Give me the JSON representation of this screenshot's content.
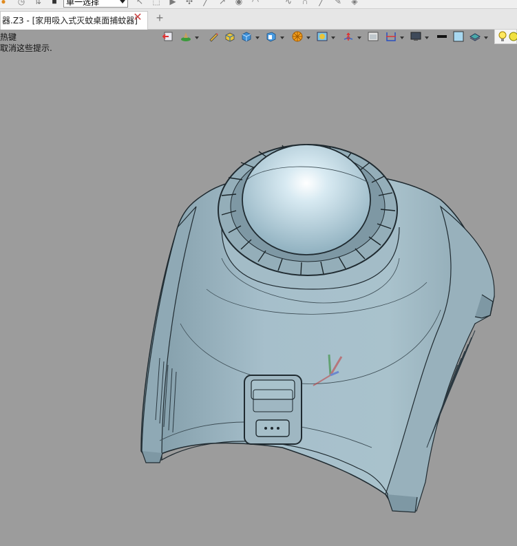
{
  "toolbar": {
    "filter_value": "单一选择",
    "icons": [
      "history-icon",
      "pin-icon",
      "stop-icon",
      "cursor-icon",
      "select-icon",
      "play-icon",
      "point-icon",
      "line-icon",
      "arrow-icon",
      "circle-icon",
      "arc-icon",
      "curve-icon",
      "spline-icon",
      "fillet-icon",
      "trim-icon",
      "brush-icon",
      "layers-icon"
    ]
  },
  "tabs": {
    "active_label": "器.Z3 - [家用吸入式灭蚊桌面捕蚊器]",
    "close_glyph": "✕",
    "add_glyph": "+"
  },
  "hints": {
    "line1": "热键",
    "line2": "取消这些提示."
  },
  "view_toolbar": {
    "icons": [
      "view-back-icon",
      "render-mode-icon",
      "pencil-icon",
      "box-yellow-icon",
      "shaded-cube-icon",
      "cube-view-icon",
      "orient-wheel-icon",
      "view-settings-icon",
      "axis-icon",
      "window-icon",
      "section-icon",
      "display-icon",
      "line-color-icon",
      "background-color-icon",
      "layer-icon",
      "light-icon"
    ]
  },
  "colors": {
    "viewport_bg": "#9c9c9c",
    "model_fill": "#a9c2cc",
    "model_edge": "#1f2a30"
  }
}
